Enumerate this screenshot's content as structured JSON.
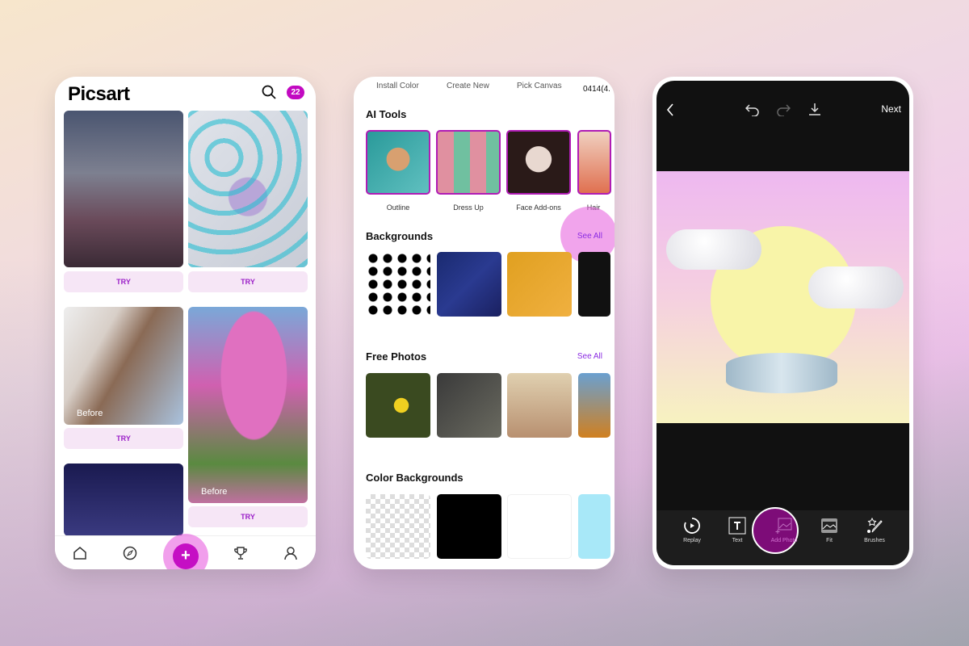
{
  "home": {
    "logo": "Picsart",
    "notification_count": "22",
    "try_label": "TRY",
    "before_label": "Before",
    "nav": [
      "home-icon",
      "compass-icon",
      "plus-icon",
      "trophy-icon",
      "profile-icon"
    ],
    "create_symbol": "+"
  },
  "create": {
    "tabs": [
      "Install Color",
      "Create New",
      "Pick Canvas",
      "0414(4."
    ],
    "ai_tools": {
      "title": "AI Tools",
      "items": [
        "Outline",
        "Dress Up",
        "Face Add-ons",
        "Hair"
      ]
    },
    "backgrounds": {
      "title": "Backgrounds",
      "see_all": "See All"
    },
    "free_photos": {
      "title": "Free Photos",
      "see_all": "See All"
    },
    "color_backgrounds": {
      "title": "Color Backgrounds"
    }
  },
  "editor": {
    "next": "Next",
    "tools": [
      "Replay",
      "Text",
      "Add Photo",
      "Fit",
      "Brushes"
    ]
  },
  "colors": {
    "accent": "#c209c1",
    "editor_bg": "#111111",
    "highlight": "#e65adc"
  }
}
